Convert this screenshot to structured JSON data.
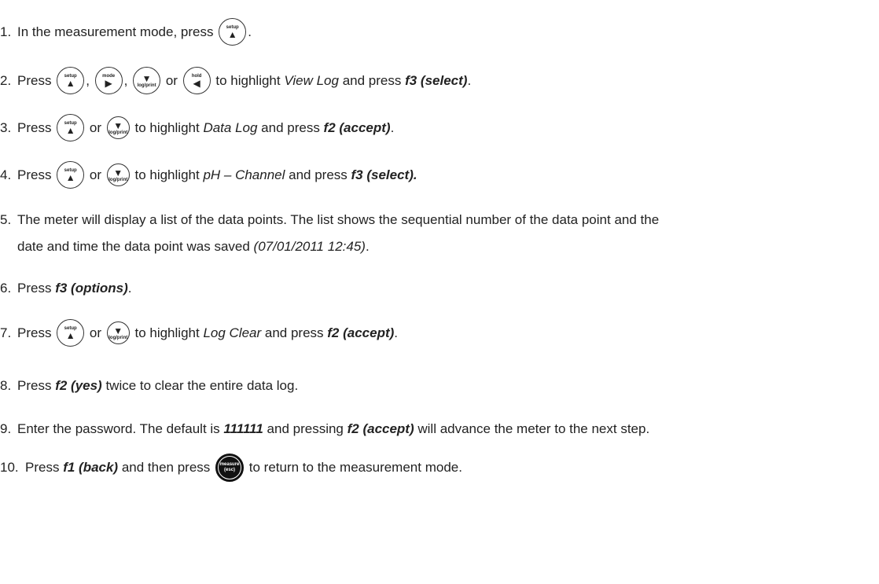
{
  "keys": {
    "setup": {
      "caption": "setup",
      "glyph": "▲"
    },
    "mode": {
      "caption": "mode",
      "glyph": "▶"
    },
    "logprint": {
      "caption": "log/print",
      "glyph": "▼"
    },
    "hold": {
      "caption": "hold",
      "glyph": "◀"
    },
    "measure": {
      "caption": "measure",
      "caption2": "(esc)"
    }
  },
  "steps": [
    {
      "num": "1.",
      "a": "In the measurement mode, press ",
      "b": "."
    },
    {
      "num": "2.",
      "a": "Press ",
      "sep1": ", ",
      "sep2": ", ",
      "or": " or ",
      "b": " to highlight ",
      "item": "View Log",
      "c": " and press ",
      "cmd": "f3 (select)",
      "d": "."
    },
    {
      "num": "3.",
      "a": "Press ",
      "or": " or ",
      "b": " to highlight ",
      "item": "Data Log",
      "c": " and press ",
      "cmd": "f2 (accept)",
      "d": "."
    },
    {
      "num": "4.",
      "a": "Press ",
      "or": " or ",
      "b": " to highlight ",
      "item": "pH – Channel",
      "c": " and press ",
      "cmd": "f3 (select)."
    },
    {
      "num": "5.",
      "line1": "The meter will display a list of the data points. The list shows the sequential number of the data point and the",
      "line2a": "date and time the data point was saved ",
      "line2em": "(07/01/2011 12:45)",
      "line2b": "."
    },
    {
      "num": "6.",
      "a": "Press ",
      "cmd": "f3 (options)",
      "b": "."
    },
    {
      "num": "7.",
      "a": "Press ",
      "or": " or ",
      "b": " to highlight ",
      "item": "Log Clear",
      "c": " and press ",
      "cmd": "f2 (accept)",
      "d": "."
    },
    {
      "num": "8.",
      "a": "Press ",
      "cmd": "f2 (yes)",
      "b": " twice to clear the entire data log."
    },
    {
      "num": "9.",
      "a": "Enter the password. The default is ",
      "pw": "111111",
      "b": " and pressing ",
      "cmd": "f2 (accept)",
      "c": " will advance the meter to the next step."
    },
    {
      "num": "10.",
      "a": "Press ",
      "cmd": "f1 (back)",
      "b": " and then press ",
      "c": " to return to the measurement mode."
    }
  ]
}
